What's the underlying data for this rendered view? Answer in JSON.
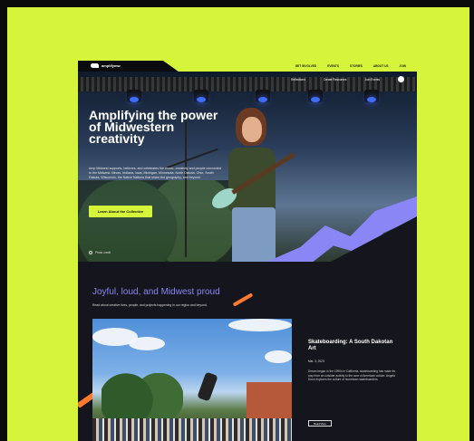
{
  "nav": {
    "logo_text": "amplifymw",
    "links": [
      "GET INVOLVED",
      "EVENTS",
      "STORIES",
      "ABOUT US",
      "JOIN"
    ]
  },
  "hero": {
    "subnav": [
      "Reflections",
      "Create Resources",
      "Join Events"
    ],
    "heading": "Amplifying the power of Midwestern creativity",
    "body": "Amp Midwest supports, believes, and celebrates the music, creativity and people connected to the Midwest: Illinois, Indiana, Iowa, Michigan, Minnesota, North Dakota, Ohio, South Dakota, Wisconsin, the Native Nations that share the geography, and beyond.",
    "cta_label": "Learn About the Collective",
    "caption": "Photo credit"
  },
  "section": {
    "heading": "Joyful, loud, and Midwest proud",
    "body": "Read about creative lives, people, and projects happening in our region and beyond."
  },
  "article": {
    "title": "Skateboarding: A South Dakotan Art",
    "date": "Mar. 3, 2023",
    "body": "Dream began in the 1990s in California, skateboarding has made its way from an outsider activity to the core of American culture. Angela Dunn explores the culture of hometown skateboarders.",
    "button_label": "Read More"
  },
  "colors": {
    "lime": "#d6f53a",
    "purple": "#8a86f5",
    "orange": "#ff7a2e",
    "dark": "#15151d"
  }
}
